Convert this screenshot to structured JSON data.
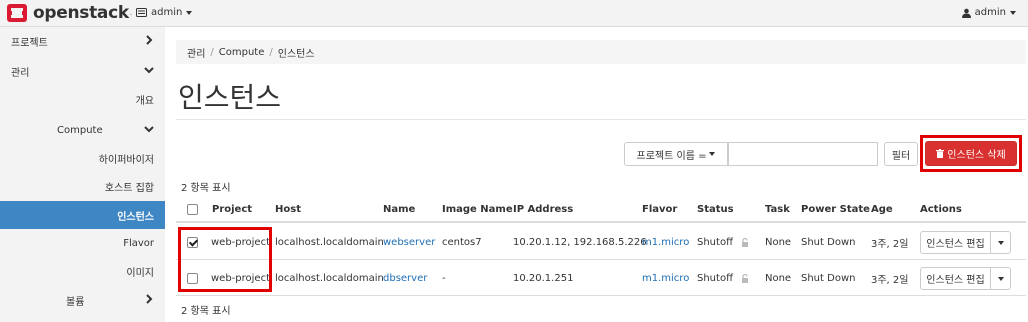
{
  "header": {
    "brand": "openstack",
    "project_selector": "admin",
    "user_menu": "admin"
  },
  "sidebar": {
    "items": [
      {
        "label": "프로젝트",
        "indent": "top",
        "chevron": "right"
      },
      {
        "label": "관리",
        "indent": "top",
        "chevron": "down"
      },
      {
        "label": "개요",
        "indent": "leaf"
      },
      {
        "label": "Compute",
        "indent": "group",
        "chevron": "down"
      },
      {
        "label": "하이퍼바이저",
        "indent": "leaf"
      },
      {
        "label": "호스트 집합",
        "indent": "leaf"
      },
      {
        "label": "인스턴스",
        "indent": "leaf",
        "active": true
      },
      {
        "label": "Flavor",
        "indent": "leaf"
      },
      {
        "label": "이미지",
        "indent": "leaf"
      },
      {
        "label": "볼륨",
        "indent": "group",
        "chevron": "right"
      }
    ]
  },
  "breadcrumb": [
    "관리",
    "Compute",
    "인스턴스"
  ],
  "page_title": "인스턴스",
  "filter": {
    "select_label": "프로젝트 이름 =",
    "input_value": "",
    "button": "필터"
  },
  "delete_button": "인스턴스 삭제",
  "count_label": "2 항목 표시",
  "table": {
    "headers": [
      "",
      "Project",
      "Host",
      "Name",
      "Image Name",
      "IP Address",
      "Flavor",
      "Status",
      "",
      "Task",
      "Power State",
      "Age",
      "Actions"
    ],
    "rows": [
      {
        "checked": true,
        "project": "web-project",
        "host": "localhost.localdomain",
        "name": "webserver",
        "image": "centos7",
        "ip": "10.20.1.12, 192.168.5.226",
        "flavor": "m1.micro",
        "status": "Shutoff",
        "task": "None",
        "power": "Shut Down",
        "age": "3주, 2일",
        "action": "인스턴스 편집"
      },
      {
        "checked": false,
        "project": "web-project",
        "host": "localhost.localdomain",
        "name": "dbserver",
        "image": "-",
        "ip": "10.20.1.251",
        "flavor": "m1.micro",
        "status": "Shutoff",
        "task": "None",
        "power": "Shut Down",
        "age": "3주, 2일",
        "action": "인스턴스 편집"
      }
    ]
  },
  "colors": {
    "accent": "#3f86c4",
    "danger": "#d9312f",
    "highlight": "#e00000",
    "logo": "#da1a32"
  }
}
